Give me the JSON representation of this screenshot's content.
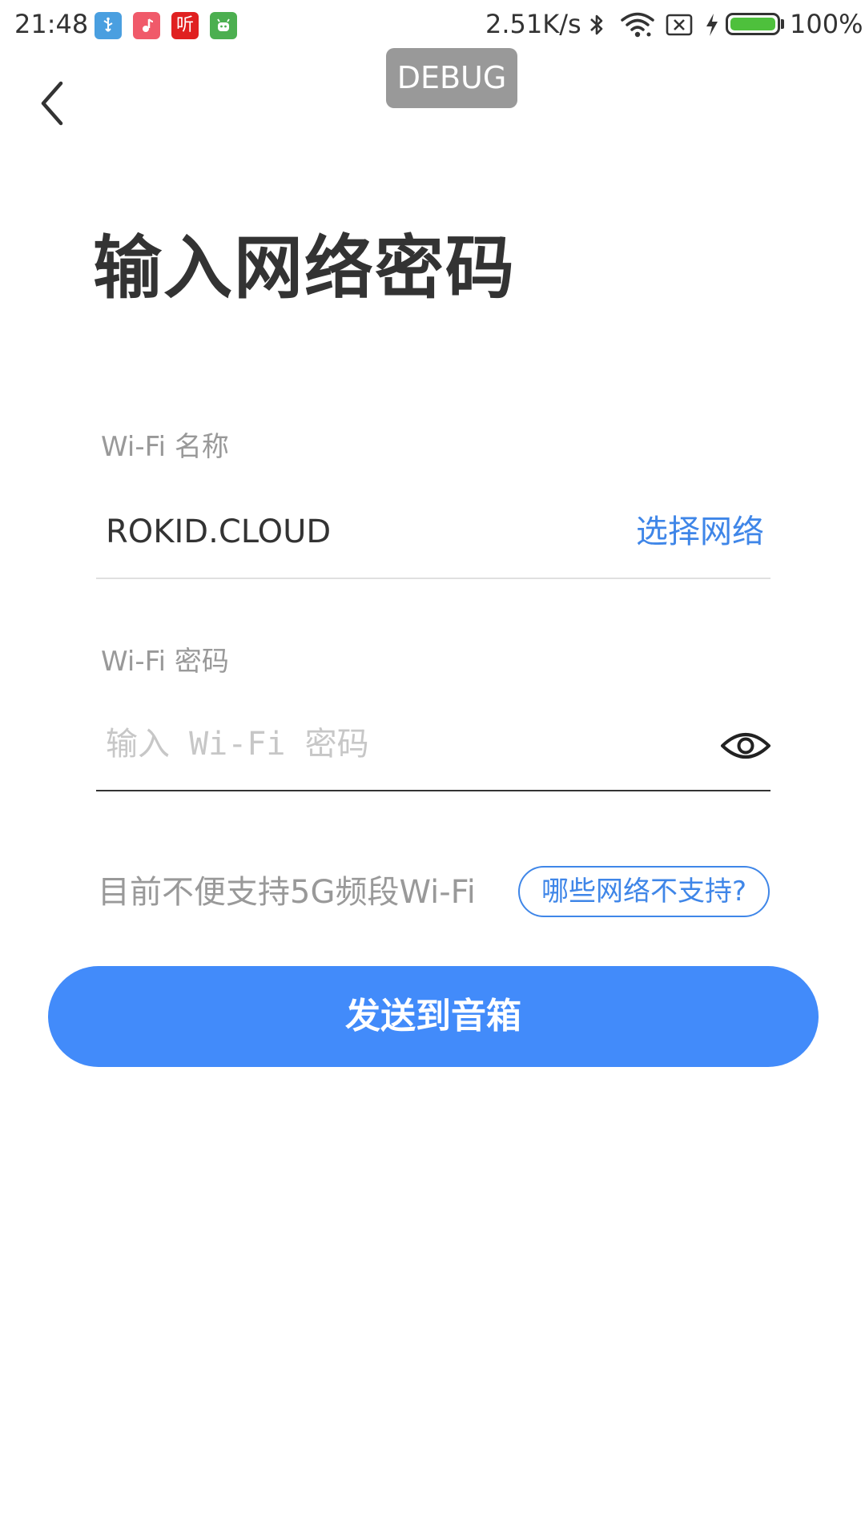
{
  "status_bar": {
    "time": "21:48",
    "apps": [
      {
        "icon": "usb-icon",
        "color": "#4a9fe0"
      },
      {
        "icon": "music-note-icon",
        "color": "#f05a6a"
      },
      {
        "icon": "listen-app-icon",
        "label": "听",
        "color": "#e02020"
      },
      {
        "icon": "android-robot-icon",
        "color": "#4caf50"
      }
    ],
    "network_speed": "2.51K/s",
    "battery_percent": "100%"
  },
  "debug_badge": "DEBUG",
  "page_title": "输入网络密码",
  "ssid": {
    "label": "Wi-Fi 名称",
    "value": "ROKID.CLOUD",
    "action": "选择网络"
  },
  "password": {
    "label": "Wi-Fi 密码",
    "placeholder": "输入 Wi-Fi 密码",
    "value": ""
  },
  "note": {
    "text": "目前不便支持5G频段Wi-Fi",
    "link": "哪些网络不支持?"
  },
  "submit_label": "发送到音箱",
  "colors": {
    "accent": "#3f86e8",
    "button": "#428bfa",
    "title": "#333333",
    "muted": "#999999"
  }
}
